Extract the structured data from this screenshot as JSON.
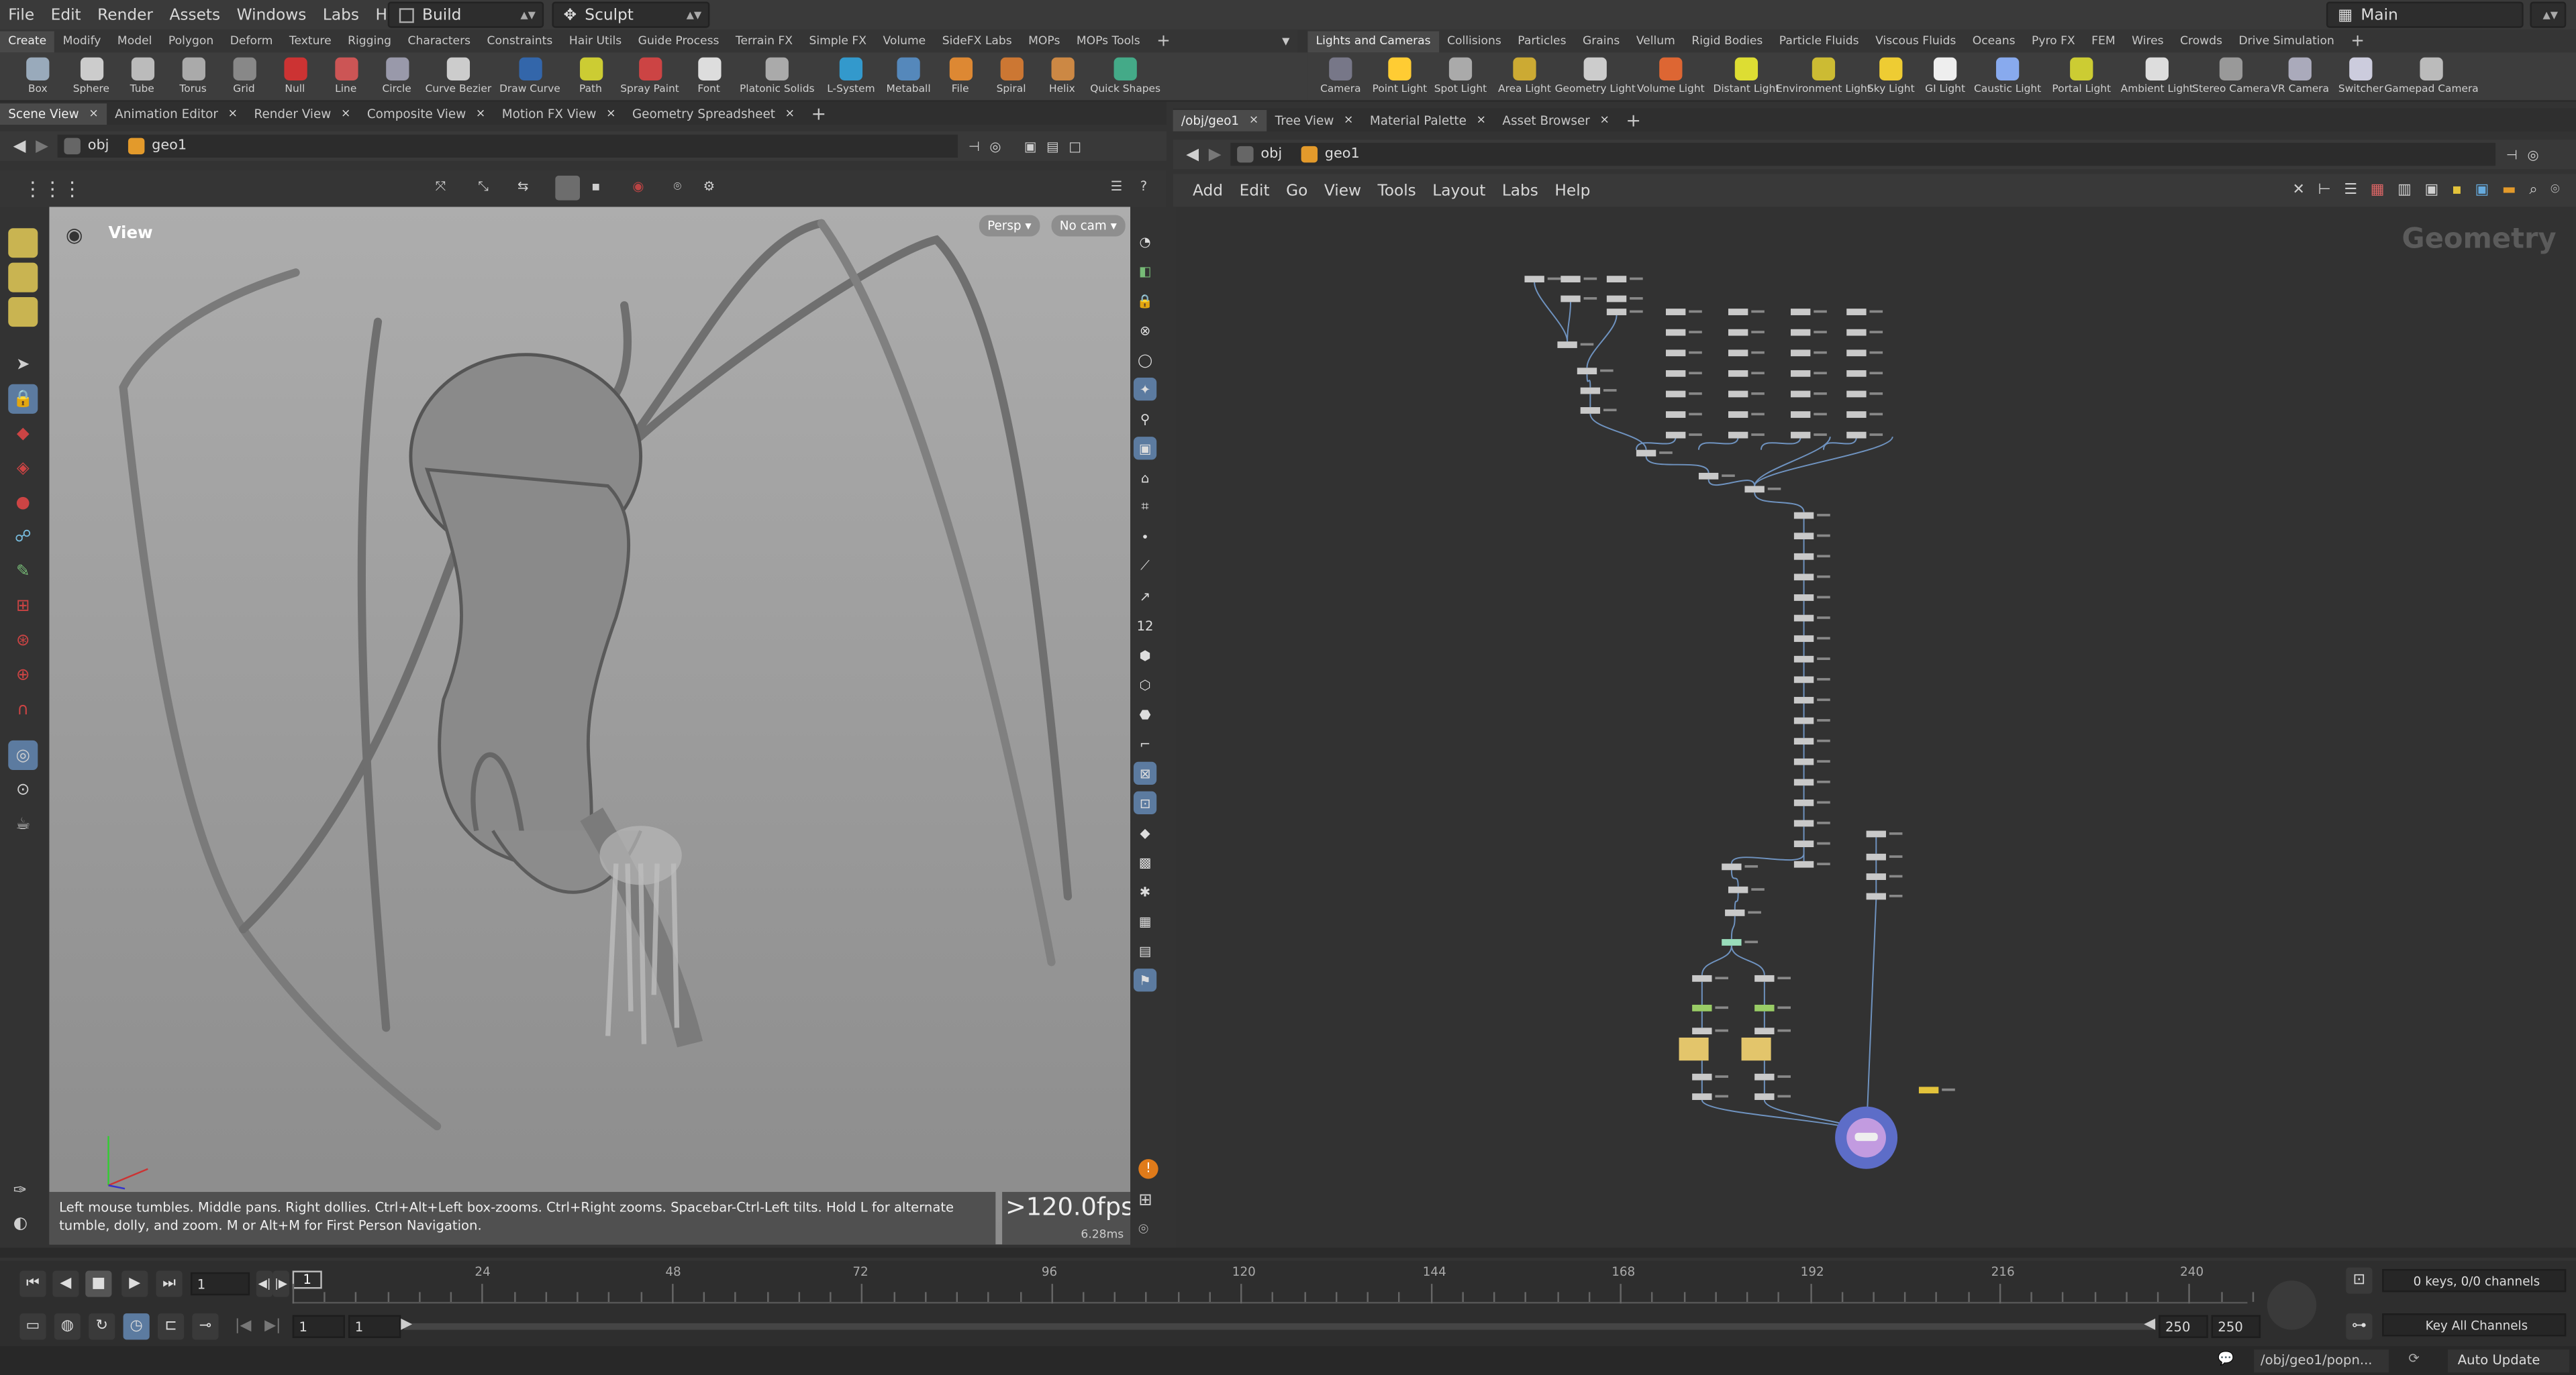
{
  "menubar": {
    "items": [
      "File",
      "Edit",
      "Render",
      "Assets",
      "Windows",
      "Labs",
      "Help"
    ],
    "desktop": "Build",
    "mode": "Sculpt",
    "main": "Main"
  },
  "shelf_left": {
    "tabs": [
      "Create",
      "Modify",
      "Model",
      "Polygon",
      "Deform",
      "Texture",
      "Rigging",
      "Characters",
      "Constraints",
      "Hair Utils",
      "Guide Process",
      "Terrain FX",
      "Simple FX",
      "Volume",
      "SideFX Labs",
      "MOPs",
      "MOPs Tools"
    ],
    "tools": [
      "Box",
      "Sphere",
      "Tube",
      "Torus",
      "Grid",
      "Null",
      "Line",
      "Circle",
      "Curve Bezier",
      "Draw Curve",
      "Path",
      "Spray Paint",
      "Font",
      "Platonic Solids",
      "L-System",
      "Metaball",
      "File",
      "Spiral",
      "Helix",
      "Quick Shapes"
    ]
  },
  "shelf_right": {
    "tabs": [
      "Lights and Cameras",
      "Collisions",
      "Particles",
      "Grains",
      "Vellum",
      "Rigid Bodies",
      "Particle Fluids",
      "Viscous Fluids",
      "Oceans",
      "Pyro FX",
      "FEM",
      "Wires",
      "Crowds",
      "Drive Simulation"
    ],
    "tools": [
      "Camera",
      "Point Light",
      "Spot Light",
      "Area Light",
      "Geometry Light",
      "Volume Light",
      "Distant Light",
      "Environment Light",
      "Sky Light",
      "GI Light",
      "Caustic Light",
      "Portal Light",
      "Ambient Light",
      "Stereo Camera",
      "VR Camera",
      "Switcher",
      "Gamepad Camera"
    ]
  },
  "left_pane": {
    "tabs": [
      "Scene View",
      "Animation Editor",
      "Render View",
      "Composite View",
      "Motion FX View",
      "Geometry Spreadsheet"
    ],
    "path": [
      "obj",
      "geo1"
    ],
    "view_label": "View",
    "persp": "Persp",
    "cam": "No cam",
    "hint": "Left mouse tumbles. Middle pans. Right dollies. Ctrl+Alt+Left box-zooms. Ctrl+Right zooms. Spacebar-Ctrl-Left tilts. Hold L for alternate tumble, dolly, and zoom.   M or Alt+M for First Person Navigation.",
    "fps": ">120.0fps",
    "ms": "6.28ms"
  },
  "right_pane": {
    "tabs": [
      "/obj/geo1",
      "Tree View",
      "Material Palette",
      "Asset Browser"
    ],
    "path": [
      "obj",
      "geo1"
    ],
    "menu": [
      "Add",
      "Edit",
      "Go",
      "View",
      "Tools",
      "Layout",
      "Labs",
      "Help"
    ],
    "context": "Geometry"
  },
  "timeline": {
    "frame": "1",
    "ticks": [
      "24",
      "48",
      "72",
      "96",
      "120",
      "144",
      "168",
      "192",
      "216",
      "240"
    ],
    "start": "1",
    "start2": "1",
    "end": "250",
    "end2": "250",
    "keys": "0 keys, 0/0 channels",
    "key_all": "Key All Channels",
    "current": "1"
  },
  "status": {
    "path": "/obj/geo1/popn...",
    "auto": "Auto Update"
  },
  "colors": {
    "accent": "#e39a2b",
    "selected": "#6aa0d8",
    "network_bg": "#323232"
  }
}
